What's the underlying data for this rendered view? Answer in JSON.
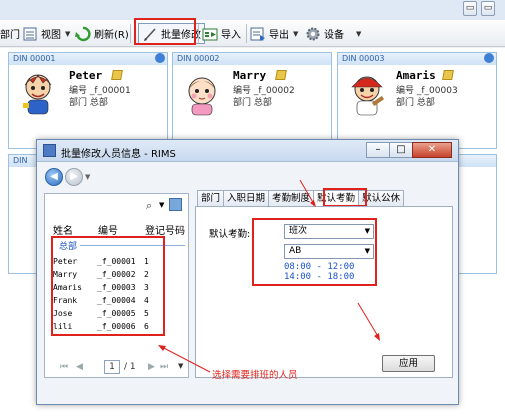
{
  "toolbar": {
    "cut_label": "部门",
    "view_label": "视图",
    "refresh_label": "刷新(R)",
    "batch_edit_label": "批量修改",
    "import_label": "导入",
    "export_label": "导出",
    "settings_label": "设备"
  },
  "window_controls": {
    "restore": "▭",
    "close": "▭"
  },
  "cards": [
    {
      "id": "DIN 00001",
      "name": "Peter",
      "number_label": "编号",
      "number": "_f_00001",
      "dept_label": "部门",
      "dept": "总部"
    },
    {
      "id": "DIN 00002",
      "name": "Marry",
      "number_label": "编号",
      "number": "_f_00002",
      "dept_label": "部门",
      "dept": "总部"
    },
    {
      "id": "DIN 00003",
      "name": "Amaris",
      "number_label": "编号",
      "number": "_f_00003",
      "dept_label": "部门",
      "dept": "总部"
    },
    {
      "id": "DIN"
    },
    {
      "id": "DIN"
    }
  ],
  "dialog": {
    "title": "批量修改人员信息 - RIMS",
    "controls": {
      "minimize": "–",
      "maximize": "□",
      "close": "✕"
    },
    "left_panel": {
      "headers": {
        "name": "姓名",
        "number": "编号",
        "reg_no": "登记号码"
      },
      "group": "总部",
      "rows": [
        {
          "name": "Peter",
          "number": "_f_00001",
          "reg": "1"
        },
        {
          "name": "Marry",
          "number": "_f_00002",
          "reg": "2"
        },
        {
          "name": "Amaris",
          "number": "_f_00003",
          "reg": "3"
        },
        {
          "name": "Frank",
          "number": "_f_00004",
          "reg": "4"
        },
        {
          "name": "Jose",
          "number": "_f_00005",
          "reg": "5"
        },
        {
          "name": "lili",
          "number": "_f_00006",
          "reg": "6"
        }
      ],
      "pager": {
        "current": "1",
        "total": "/ 1"
      }
    },
    "tabs": [
      "部门",
      "入职日期",
      "考勤制度",
      "默认考勤",
      "默认公休"
    ],
    "active_tab": "默认考勤",
    "default_attendance_label": "默认考勤:",
    "shift_select": "班次",
    "shift_code_select": "AB",
    "times": [
      "08:00 - 12:00",
      "14:00 - 18:00"
    ],
    "apply_label": "应用"
  },
  "annotation": "选择需要排班的人员",
  "colors": {
    "highlight": "#e0221c",
    "accent_blue": "#1b52c4"
  }
}
